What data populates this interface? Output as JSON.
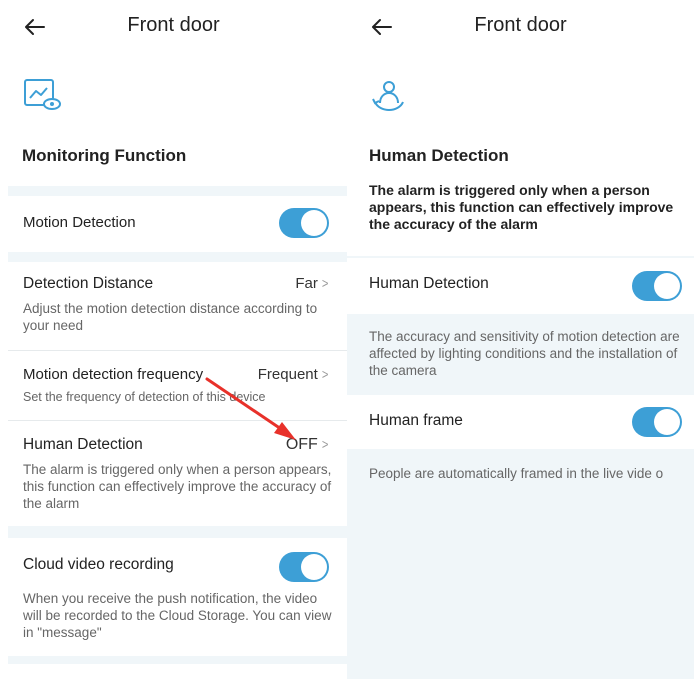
{
  "left": {
    "title": "Front door",
    "section_title": "Monitoring Function",
    "hero_icon": "monitor-eye-icon",
    "motion_detection": {
      "label": "Motion Detection",
      "enabled": true
    },
    "detection_distance": {
      "label": "Detection Distance",
      "value": "Far",
      "description": "Adjust the motion detection distance according to your need"
    },
    "motion_frequency": {
      "label": "Motion detection frequency",
      "value": "Frequent",
      "description": "Set the frequency of detection of this device"
    },
    "human_detection": {
      "label": "Human Detection",
      "value": "OFF",
      "description": "The alarm is triggered only when a person appears, this function can effectively improve the accuracy of the alarm"
    },
    "cloud_recording": {
      "label": "Cloud video recording",
      "enabled": true,
      "description": "When you receive the push notification, the video will be recorded to the Cloud Storage. You can view in \"message\""
    },
    "annotation_color": "#e8312a"
  },
  "right": {
    "title": "Front door",
    "hero_icon": "person-detection-icon",
    "section_title": "Human Detection",
    "section_description": "The alarm is triggered only when a person appears, this function can effectively improve the accuracy of the alarm",
    "human_detection": {
      "label": "Human Detection",
      "enabled": true
    },
    "human_detection_note": "The accuracy and sensitivity of motion detection are affected by lighting conditions and the installation of the camera",
    "human_frame": {
      "label": "Human frame",
      "enabled": true
    },
    "human_frame_note": "People are automatically framed in the live vide o"
  },
  "colors": {
    "accent": "#3d9fd6",
    "background_gray": "#f0f6f9"
  }
}
